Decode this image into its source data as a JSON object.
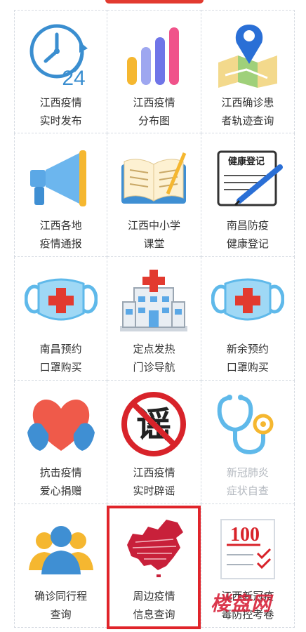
{
  "colors": {
    "accent": "#e0242a",
    "text": "#333333",
    "muted": "#b3b8bf"
  },
  "tiles": [
    {
      "label": "江西疫情\n实时发布",
      "icon": "clock-24-icon"
    },
    {
      "label": "江西疫情\n分布图",
      "icon": "bar-chart-icon"
    },
    {
      "label": "江西确诊患\n者轨迹查询",
      "icon": "map-pin-icon"
    },
    {
      "label": "江西各地\n疫情通报",
      "icon": "megaphone-icon"
    },
    {
      "label": "江西中小学\n课堂",
      "icon": "open-book-icon"
    },
    {
      "label": "南昌防疫\n健康登记",
      "icon": "health-register-icon",
      "icon_text": "健康登记"
    },
    {
      "label": "南昌预约\n口罩购买",
      "icon": "face-mask-icon"
    },
    {
      "label": "定点发热\n门诊导航",
      "icon": "hospital-icon"
    },
    {
      "label": "新余预约\n口罩购买",
      "icon": "face-mask-icon"
    },
    {
      "label": "抗击疫情\n爱心捐赠",
      "icon": "heart-hands-icon"
    },
    {
      "label": "江西疫情\n实时辟谣",
      "icon": "no-rumor-icon",
      "icon_text": "谣"
    },
    {
      "label": "新冠肺炎\n症状自查",
      "icon": "stethoscope-icon",
      "muted": true
    },
    {
      "label": "确诊同行程\n查询",
      "icon": "people-icon"
    },
    {
      "label": "周边疫情\n信息查询",
      "icon": "china-map-icon"
    },
    {
      "label": "江西新冠疫\n毒防控考卷",
      "icon": "exam-paper-icon",
      "icon_text": "100"
    }
  ],
  "watermark": "楼盘网"
}
